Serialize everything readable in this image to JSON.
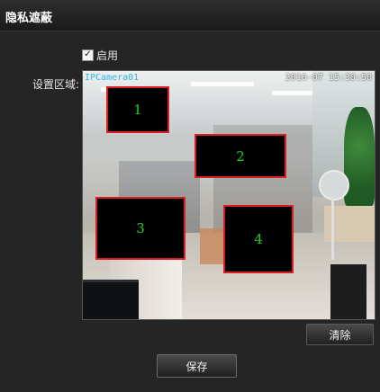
{
  "header": {
    "title": "隐私遮蔽"
  },
  "enable": {
    "label": "启用",
    "checked": true,
    "check_glyph": "✓"
  },
  "area": {
    "label": "设置区域:"
  },
  "video": {
    "camera_name": "IPCamera01",
    "timestamp": "2016-07  15:30:50"
  },
  "masks": [
    {
      "number": "1"
    },
    {
      "number": "2"
    },
    {
      "number": "3"
    },
    {
      "number": "4"
    }
  ],
  "buttons": {
    "clear": "清除",
    "save": "保存"
  },
  "colors": {
    "mask_border": "#d82020",
    "mask_number": "#1fd21f",
    "camera_label": "#2fb6e8"
  }
}
